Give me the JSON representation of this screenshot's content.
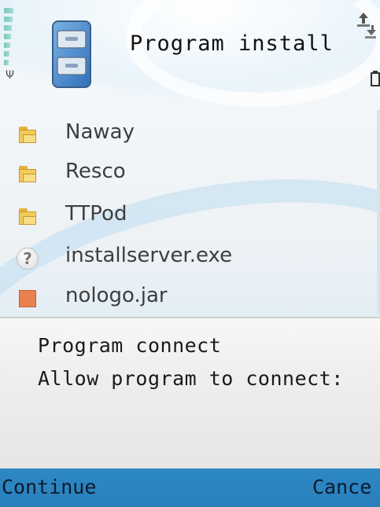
{
  "header": {
    "title": "Program install"
  },
  "files": [
    {
      "name": "Naway",
      "icon": "folder-icon"
    },
    {
      "name": "Resco",
      "icon": "folder-icon"
    },
    {
      "name": "TTPod",
      "icon": "folder-icon"
    },
    {
      "name": "installserver.exe",
      "icon": "unknown-file-icon"
    },
    {
      "name": "nologo.jar",
      "icon": "jar-file-icon"
    }
  ],
  "dialog": {
    "title": "Program connect",
    "message": "Allow program to connect:"
  },
  "softkeys": {
    "left": "Continue",
    "right": "Cance"
  },
  "colors": {
    "softkey_bar": "#2d88c4",
    "folder": "#f1cb59",
    "jar": "#e8804f",
    "list_text": "#3e3e3e"
  }
}
